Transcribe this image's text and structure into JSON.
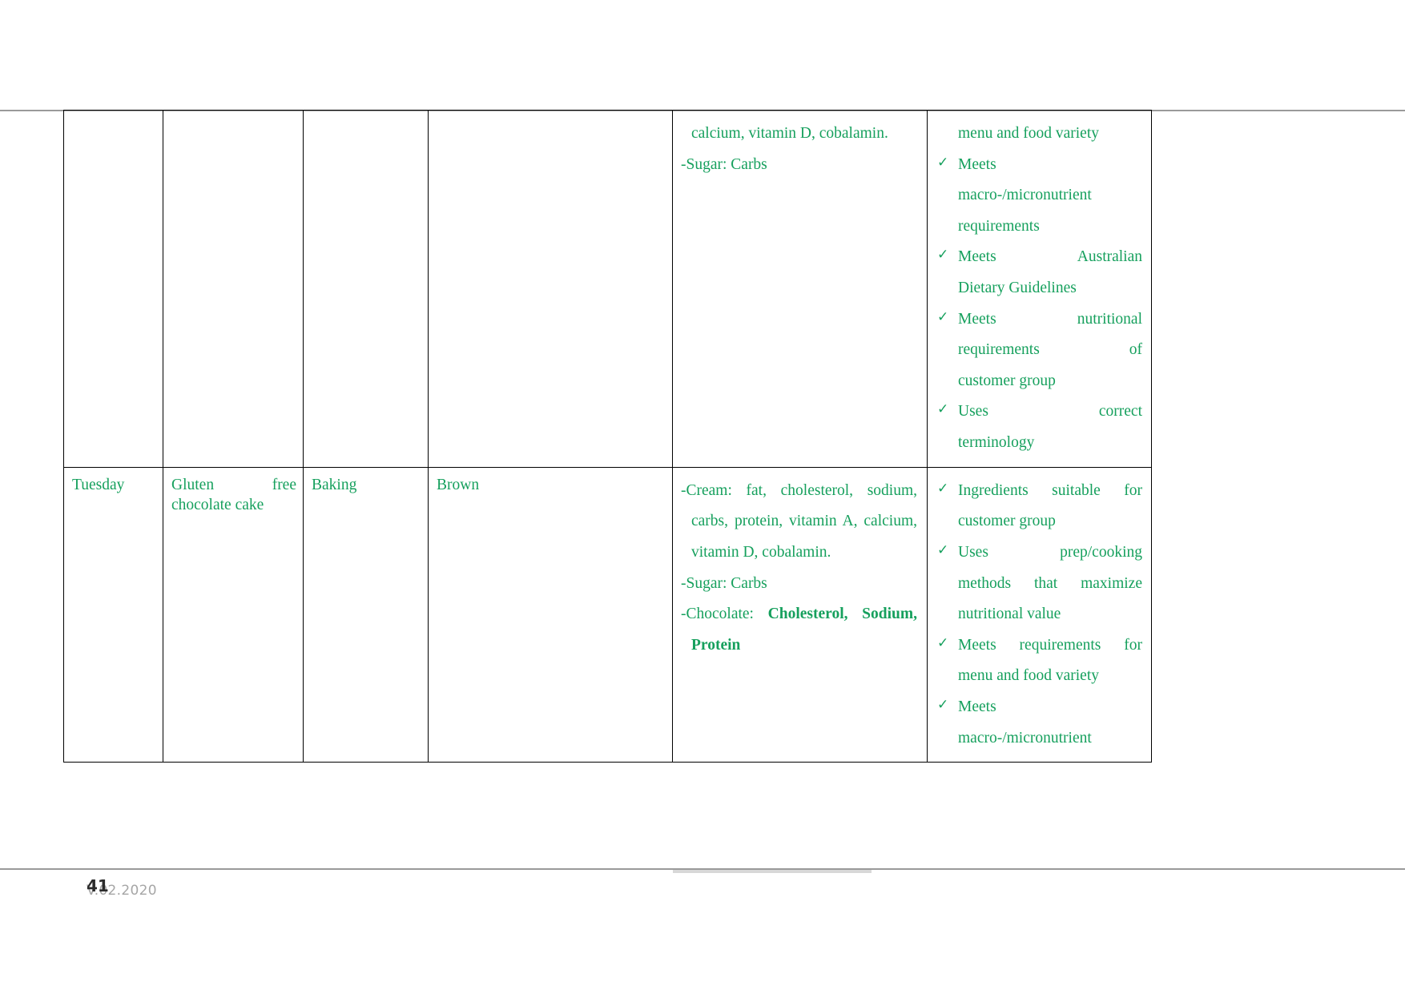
{
  "document": {
    "page_number": "41",
    "version": "V.02.2020",
    "text_color": "#16a05d",
    "border_color": "#000000",
    "rule_color": "#9a9a9a"
  },
  "icons": {
    "check": "✓"
  },
  "table": {
    "rows": [
      {
        "id": "continued-row",
        "day": "",
        "dish": "",
        "method": "",
        "colour": "",
        "nutrition_lines": [
          "calcium, vitamin D, cobalamin.",
          "-Sugar: Carbs"
        ],
        "checklist": [
          {
            "marked": false,
            "lines": [
              "menu and food variety"
            ]
          },
          {
            "marked": true,
            "lines": [
              "Meets",
              "macro-/micronutrient",
              "requirements"
            ]
          },
          {
            "marked": true,
            "lines": [
              "Meets            Australian",
              "Dietary Guidelines"
            ]
          },
          {
            "marked": true,
            "lines": [
              "Meets            nutritional",
              "requirements                 of",
              "customer group"
            ]
          },
          {
            "marked": true,
            "lines": [
              "Uses                 correct",
              "terminology"
            ]
          }
        ]
      },
      {
        "id": "tuesday-row",
        "day": "Tuesday",
        "dish": "Gluten free chocolate cake",
        "method": "Baking",
        "colour": "Brown",
        "nutrition_items": [
          {
            "lead": "-Cream:",
            "rest": " fat, cholesterol, sodium, carbs, protein, vitamin A, calcium, vitamin D, cobalamin.",
            "bold_rest": ""
          },
          {
            "lead": "-Sugar:",
            "rest": " Carbs",
            "bold_rest": ""
          },
          {
            "lead": "-Chocolate:",
            "rest": " ",
            "bold_rest": "Cholesterol, Sodium, Protein"
          }
        ],
        "checklist": [
          {
            "marked": true,
            "lines": [
              "Ingredients suitable for",
              "customer group"
            ]
          },
          {
            "marked": true,
            "lines": [
              "Uses            prep/cooking",
              "methods that maximize",
              "nutritional value"
            ]
          },
          {
            "marked": true,
            "lines": [
              "Meets requirements for",
              "menu and food variety"
            ]
          },
          {
            "marked": true,
            "lines": [
              "Meets",
              "macro-/micronutrient"
            ]
          }
        ]
      }
    ]
  }
}
